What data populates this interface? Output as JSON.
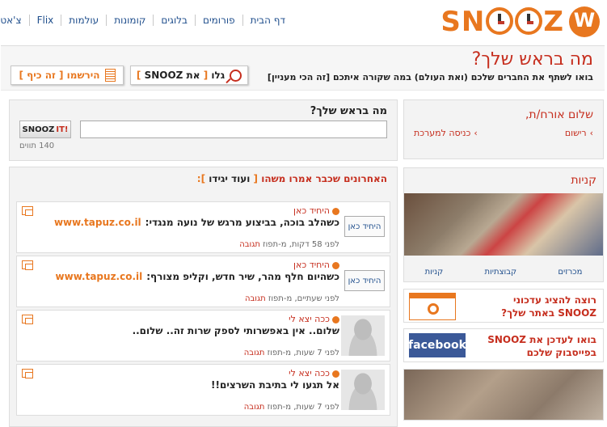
{
  "brand": {
    "logo_text": "SNOOZ",
    "logo_prefix": "SN",
    "logo_suffix": "Z"
  },
  "nav": [
    "דף הבית",
    "פורומים",
    "בלוגים",
    "קומונות",
    "עולמות",
    "Flix",
    "צ'אט"
  ],
  "header": {
    "title": "מה בראש שלך?",
    "subtitle": "בואו לשתף את החברים שלכם (ואת העולם) במה שקורה איתכם [זה הכי מעניין]",
    "browse_button": {
      "prefix": "גלו",
      "open": "[",
      "label": "את SNOOZ",
      "close": "]"
    },
    "register_button": {
      "prefix": "הירשמו",
      "label": "[ זה כיף ]"
    }
  },
  "welcome": {
    "title": "שלום אורח/ת,",
    "register": "רישום",
    "login": "כניסה למערכת"
  },
  "shops": {
    "title": "קניות",
    "tabs": [
      "מכרזים",
      "קבוצתיות",
      "קניות"
    ]
  },
  "promo": {
    "line1": "רוצה להציג עדכוני",
    "line2": "SNOOZ באתר שלך?"
  },
  "facebook": {
    "line1": "בואו לעדכן את SNOOZ",
    "line2": "בפייסבוק שלכם",
    "logo": "facebook"
  },
  "ask": {
    "title": "מה בראש שלך?",
    "input_value": "",
    "button_main": "SNOOZ",
    "button_accent": "IT!",
    "char_count": "140 תווים"
  },
  "feed": {
    "title": "האחרונים שכבר אמרו משהו",
    "more_open": "[",
    "more": "ועוד יגידו",
    "more_close": "]:",
    "posts": [
      {
        "user": "היחיד כאן",
        "avatar_alt": "היחיד כאן",
        "text": "כשהלב בוכה, בביצוע מרגש של נועה מנגדי:",
        "link": "www.tapuz.co.il",
        "time": "לפני 58 דקות, מ-תפוז",
        "reply": "תגובה"
      },
      {
        "user": "היחיד כאן",
        "avatar_alt": "היחיד כאן",
        "text": "כשהיום חלף מהר, שיר חדש, וקליפ מצורף:",
        "link": "www.tapuz.co.il",
        "time": "לפני שעתיים, מ-תפוז",
        "reply": "תגובה"
      },
      {
        "user": "ככה יצא לי",
        "avatar_alt": "",
        "text": "שלום.. אין באפשרותי לספק שרות זה.. שלום..",
        "link": "",
        "time": "לפני 7 שעות, מ-תפוז",
        "reply": "תגובה"
      },
      {
        "user": "ככה יצא לי",
        "avatar_alt": "",
        "text": "אל תגעו לי בתיבת השרצים!!",
        "link": "",
        "time": "לפני 7 שעות, מ-תפוז",
        "reply": "תגובה"
      }
    ]
  },
  "colors": {
    "brand_orange": "#e8771f",
    "title_red": "#c62e1e",
    "link_blue": "#1f4e8c",
    "facebook_blue": "#3b5998"
  }
}
